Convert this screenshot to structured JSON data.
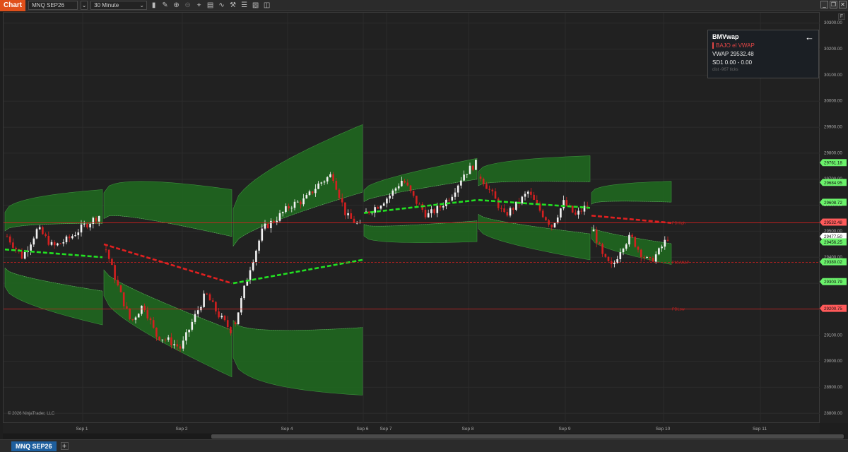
{
  "app_label": "Chart",
  "toolbar": {
    "instrument": "MNQ SEP26",
    "interval": "30 Minute"
  },
  "window_controls": {
    "minimize": "_",
    "restore": "❐",
    "close": "✕"
  },
  "corner_label": "F",
  "overlay": {
    "title": "BMVwap",
    "status": "BAJO el VWAP",
    "vwap": "VWAP  29532.48",
    "sd": "SD1   0.00 - 0.00",
    "dist": "dist  -967 ticks"
  },
  "copyright": "© 2026 NinjaTrader, LLC",
  "price_axis": {
    "ticks": [
      30300,
      30200,
      30100,
      30000,
      29900,
      29800,
      29700,
      29600,
      29500,
      29400,
      29300,
      29200,
      29100,
      29000,
      28900,
      28800
    ],
    "tick_labels": [
      "30300.00",
      "30200.00",
      "30100.00",
      "30000.00",
      "29900.00",
      "29800.00",
      "29700.00",
      "29600.00",
      "29500.00",
      "29400.00",
      "29300.00",
      "29200.00",
      "29100.00",
      "29000.00",
      "28900.00",
      "28800.00"
    ],
    "markers": [
      {
        "value": 29761.18,
        "label": "29761.18",
        "color": "#6bf26b"
      },
      {
        "value": 29684.95,
        "label": "29684.95",
        "color": "#6bf26b"
      },
      {
        "value": 29608.72,
        "label": "29608.72",
        "color": "#6bf26b"
      },
      {
        "value": 29532.48,
        "label": "29532.48",
        "color": "#ff5a5a"
      },
      {
        "value": 29477.5,
        "label": "29477.50",
        "color": "#ffffff"
      },
      {
        "value": 29456.25,
        "label": "29456.25",
        "color": "#6bf26b"
      },
      {
        "value": 29380.02,
        "label": "29380.02",
        "color": "#6bf26b"
      },
      {
        "value": 29303.79,
        "label": "29303.79",
        "color": "#6bf26b"
      },
      {
        "value": 29200.75,
        "label": "29200.75",
        "color": "#ff5a5a"
      }
    ]
  },
  "time_axis": {
    "labels": [
      "Sep 1",
      "Sep 2",
      "Sep 4",
      "Sep 6",
      "Sep 7",
      "Sep 8",
      "Sep 9",
      "Sep 10",
      "Sep 11"
    ]
  },
  "chart_data": {
    "type": "candlestick",
    "instrument": "MNQ SEP26",
    "interval": "30 Minute",
    "ylim": [
      28760,
      30340
    ],
    "horizontal_lines": [
      {
        "label": "PDHigh",
        "value": 29532.48,
        "color": "#d42020"
      },
      {
        "label": "PMVWAP",
        "value": 29380.02,
        "color": "#d42020"
      },
      {
        "label": "PDLow",
        "value": 29200.75,
        "color": "#d42020"
      }
    ],
    "sessions": [
      {
        "name": "Sep 1",
        "vwap_start": 29430,
        "vwap_end": 29400,
        "band_width": 130,
        "close_path": [
          29480,
          29400,
          29510,
          29440,
          29470,
          29520,
          29560
        ]
      },
      {
        "name": "Sep 2",
        "vwap_start": 29450,
        "vwap_end": 29300,
        "band_width": 180,
        "close_path": [
          29430,
          29280,
          29150,
          29220,
          29100,
          29080,
          29050,
          29160,
          29260,
          29180,
          29120
        ]
      },
      {
        "name": "Sep 4",
        "vwap_start": 29300,
        "vwap_end": 29390,
        "band_width": 260,
        "close_path": [
          29150,
          29350,
          29510,
          29550,
          29600,
          29620,
          29680,
          29720,
          29560,
          29520
        ]
      },
      {
        "name": "Sep 7",
        "vwap_start": 29570,
        "vwap_end": 29620,
        "band_width": 80,
        "close_path": [
          29570,
          29600,
          29640,
          29700,
          29620,
          29560,
          29590,
          29640,
          29720,
          29760
        ]
      },
      {
        "name": "Sep 8",
        "vwap_start": 29620,
        "vwap_end": 29590,
        "band_width": 100,
        "close_path": [
          29710,
          29640,
          29560,
          29600,
          29650,
          29580,
          29520,
          29610,
          29560,
          29600
        ]
      },
      {
        "name": "Sep 10",
        "vwap_start": 29560,
        "vwap_end": 29532,
        "band_width": 80,
        "close_path": [
          29500,
          29400,
          29360,
          29440,
          29480,
          29420,
          29380,
          29420,
          29477
        ]
      }
    ]
  }
}
